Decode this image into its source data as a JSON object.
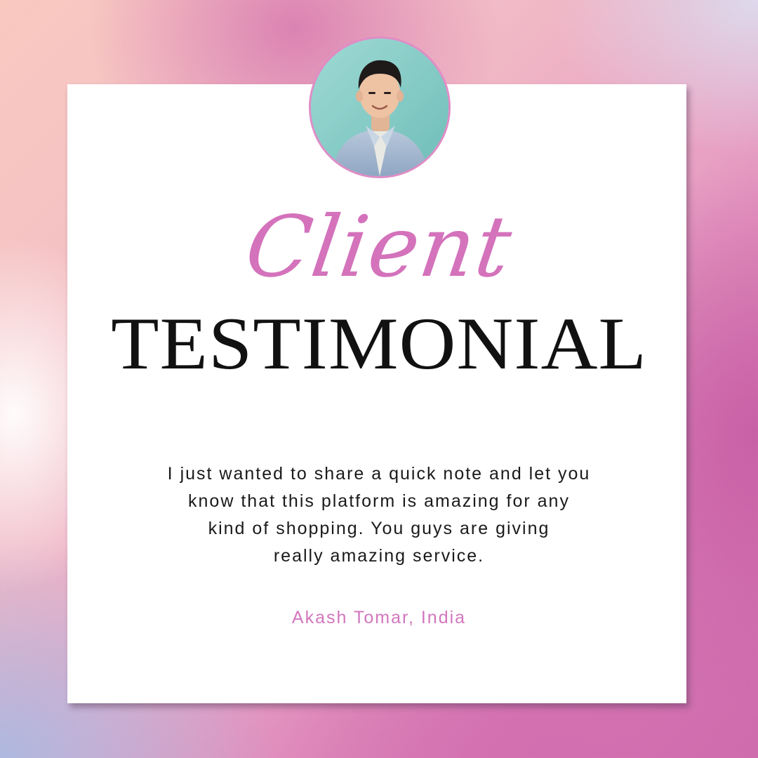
{
  "title": {
    "script": "Client",
    "main": "TESTIMONIAL"
  },
  "quote": {
    "lines": [
      "I just wanted to share a quick note and let you",
      "know that this platform is amazing for any",
      "kind of shopping. You guys are giving",
      "really amazing service."
    ]
  },
  "author": "Akash Tomar, India",
  "colors": {
    "accent_pink": "#d472bb",
    "title_black": "#111111",
    "card_white": "#ffffff",
    "avatar_ring": "#e08cc6"
  }
}
